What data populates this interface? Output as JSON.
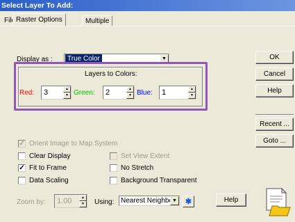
{
  "window": {
    "title": "Select Layer To Add:"
  },
  "tabs": [
    "File",
    "Raster Options",
    "Multiple"
  ],
  "display": {
    "label": "Display as :",
    "value": "True Color"
  },
  "colors": {
    "group_label": "Layers to Colors:",
    "red": {
      "label": "Red:",
      "value": "3"
    },
    "green": {
      "label": "Green:",
      "value": "2"
    },
    "blue": {
      "label": "Blue:",
      "value": "1"
    }
  },
  "buttons": {
    "ok": "OK",
    "cancel": "Cancel",
    "help": "Help",
    "recent": "Recent ...",
    "goto": "Goto ..."
  },
  "options": {
    "orient": "Orient Image to Map System",
    "clear_display": "Clear Display",
    "set_view_extent": "Set View Extent",
    "fit_to_frame": "Fit to Frame",
    "no_stretch": "No Stretch",
    "data_scaling": "Data Scaling",
    "background_transparent": "Background Transparent"
  },
  "zoom": {
    "label": "Zoom by:",
    "value": "1.00",
    "using_label": "Using:",
    "method": "Nearest Neighbor",
    "help": "Help"
  },
  "accent_colors": {
    "red": "#ff0000",
    "green": "#00c800",
    "blue": "#0000ff",
    "highlight": "#8e57b9",
    "title_bar": "#2a5fc9"
  }
}
